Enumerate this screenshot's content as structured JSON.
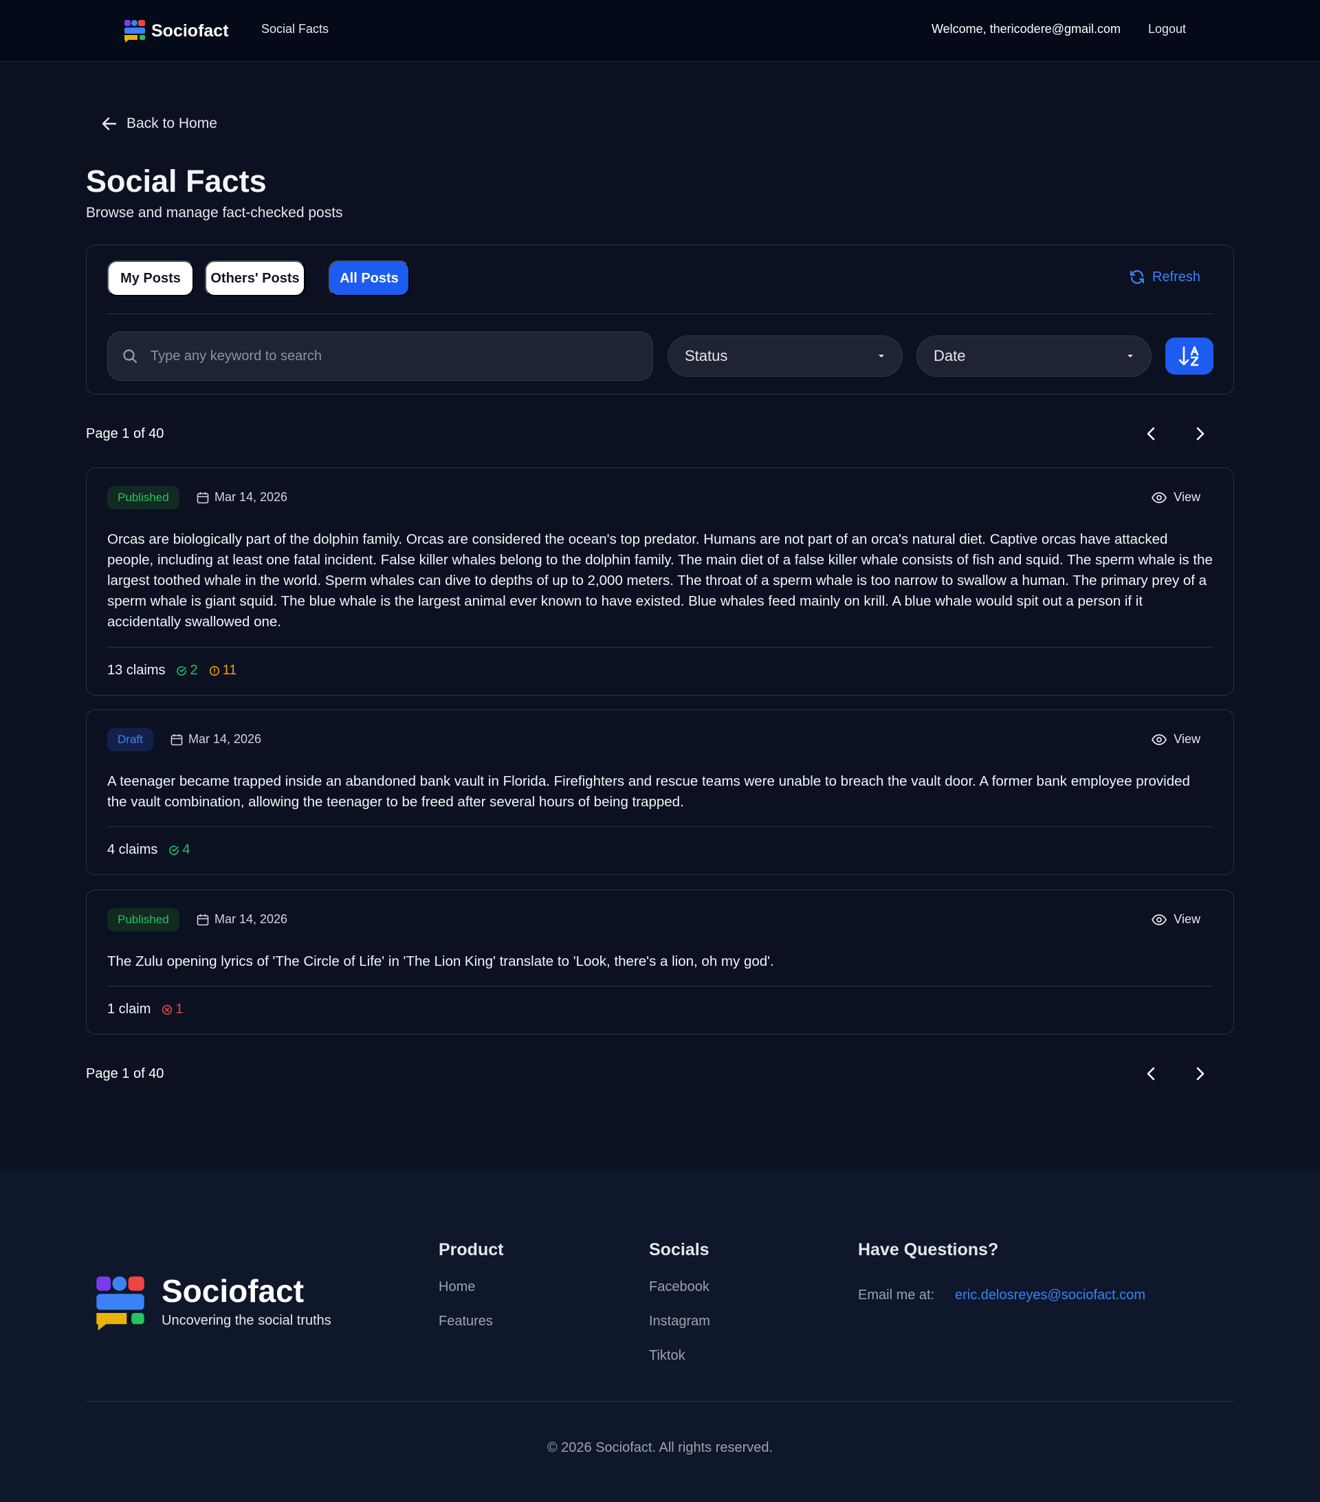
{
  "header": {
    "brand": "Sociofact",
    "nav_link": "Social Facts",
    "welcome": "Welcome, thericodere@gmail.com",
    "logout": "Logout"
  },
  "page": {
    "back_label": "Back to Home",
    "title": "Social Facts",
    "subtitle": "Browse and manage fact-checked posts"
  },
  "filters": {
    "tabs": [
      {
        "label": "My Posts",
        "active": false
      },
      {
        "label": "Others' Posts",
        "active": false
      },
      {
        "label": "All Posts",
        "active": true
      }
    ],
    "refresh_label": "Refresh",
    "search_placeholder": "Type any keyword to search",
    "search_value": "",
    "status_label": "Status",
    "date_label": "Date"
  },
  "pagination": {
    "label": "Page 1 of 40"
  },
  "posts": [
    {
      "status": "Published",
      "date": "Mar 14, 2026",
      "view_label": "View",
      "text": "Orcas are biologically part of the dolphin family. Orcas are considered the ocean's top predator. Humans are not part of an orca's natural diet. Captive orcas have attacked people, including at least one fatal incident. False killer whales belong to the dolphin family. The main diet of a false killer whale consists of fish and squid. The sperm whale is the largest toothed whale in the world. Sperm whales can dive to depths of up to 2,000 meters. The throat of a sperm whale is too narrow to swallow a human. The primary prey of a sperm whale is giant squid. The blue whale is the largest animal ever known to have existed. Blue whales feed mainly on krill. A blue whale would spit out a person if it accidentally swallowed one.",
      "claims_label": "13 claims",
      "verified": "2",
      "warning": "11"
    },
    {
      "status": "Draft",
      "date": "Mar 14, 2026",
      "view_label": "View",
      "text": "A teenager became trapped inside an abandoned bank vault in Florida. Firefighters and rescue teams were unable to breach the vault door. A former bank employee provided the vault combination, allowing the teenager to be freed after several hours of being trapped.",
      "claims_label": "4 claims",
      "verified": "4"
    },
    {
      "status": "Published",
      "date": "Mar 14, 2026",
      "view_label": "View",
      "text": "The Zulu opening lyrics of 'The Circle of Life' in 'The Lion King' translate to 'Look, there's a lion, oh my god'.",
      "claims_label": "1 claim",
      "false_count": "1"
    }
  ],
  "footer": {
    "brand": "Sociofact",
    "tagline": "Uncovering the social truths",
    "product_title": "Product",
    "product_links": [
      "Home",
      "Features"
    ],
    "socials_title": "Socials",
    "social_links": [
      "Facebook",
      "Instagram",
      "Tiktok"
    ],
    "questions_title": "Have Questions?",
    "email_label": "Email me at:",
    "email": "eric.delosreyes@sociofact.com",
    "copyright": "© 2026 Sociofact. All rights reserved."
  },
  "colors": {
    "background": "#0b1120",
    "accent": "#1d5cf0",
    "published": "#22c55e",
    "draft": "#3b82f6",
    "warning": "#f59e0b",
    "false": "#ef4444"
  },
  "icons": [
    "sociofact-logo",
    "arrow-left-icon",
    "refresh-icon",
    "search-icon",
    "caret-down-icon",
    "sort-alpha-icon",
    "chevron-left-icon",
    "chevron-right-icon",
    "calendar-icon",
    "eye-icon",
    "check-circle-icon",
    "alert-circle-icon",
    "x-circle-icon"
  ]
}
